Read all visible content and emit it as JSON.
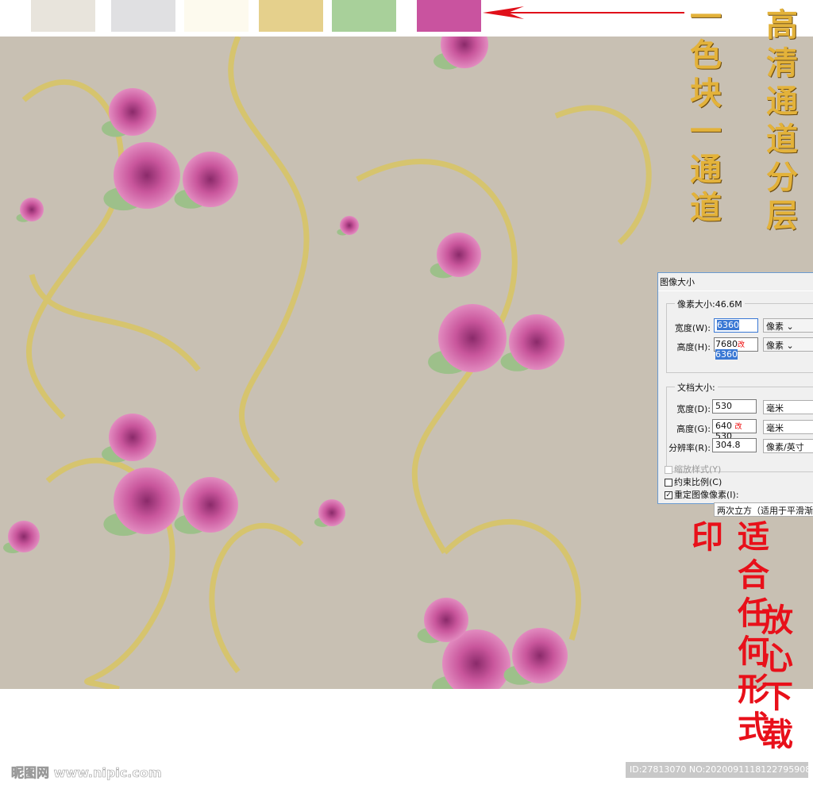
{
  "swatches": [
    "#e8e4dc",
    "#e0e0e2",
    "#fdfaee",
    "#e5d08c",
    "#a8d09a",
    "#c9539f"
  ],
  "arrow_color": "#e0101a",
  "texts": {
    "left_gold": "一色块一通道",
    "right_gold": "高清通道分层",
    "left_red": "适合任何形式印",
    "right_red": "放心下载"
  },
  "dialog": {
    "title": "图像大小",
    "pixel_group": "像素大小:46.6M",
    "width_label": "宽度(W):",
    "width_value": "6360",
    "width_unit": "像素",
    "height_label": "高度(H):",
    "height_old": "7680",
    "height_mark": "改",
    "height_value": "6360",
    "height_unit": "像素",
    "doc_group": "文档大小:",
    "doc_width_label": "宽度(D):",
    "doc_width_value": "530",
    "doc_width_unit": "毫米",
    "doc_height_label": "高度(G):",
    "doc_height_old": "640",
    "doc_height_mark": "改",
    "doc_height_value": "530",
    "doc_height_unit": "毫米",
    "res_label": "分辨率(R):",
    "res_value": "304.8",
    "res_unit": "像素/英寸",
    "scale_styles": "缩放样式(Y)",
    "constrain": "约束比例(C)",
    "resample": "重定图像像素(I):",
    "resample_method": "两次立方（适用于平滑渐变"
  },
  "watermark": {
    "logo": "昵图网 www.nipic.com",
    "id": "ID:27813070 NO:20200911181227959080"
  }
}
